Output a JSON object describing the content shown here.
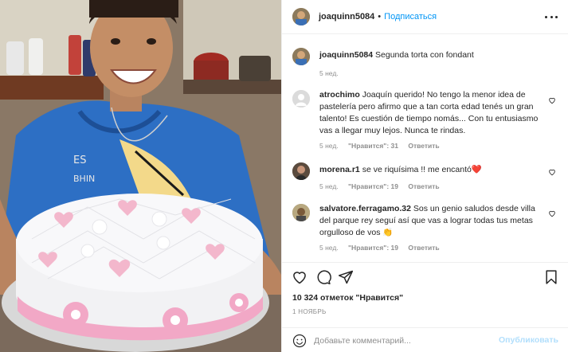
{
  "post": {
    "username": "joaquinn5084",
    "separator": "•",
    "follow_label": "Подписаться",
    "caption": "Segunda torta con fondant",
    "caption_age": "5 нед."
  },
  "comments": [
    {
      "username": "atrochimo",
      "text": "Joaquín querido! No tengo la menor idea de pastelería pero afirmo que a tan corta edad tenés un gran talento! Es cuestión de tiempo nomás... Con tu entusiasmo vas a llegar muy lejos. Nunca te rindas.",
      "age": "5 нед.",
      "likes": "\"Нравится\": 31",
      "reply": "Ответить"
    },
    {
      "username": "morena.r1",
      "text": "se ve riquísima !! me encantó❤️",
      "age": "5 нед.",
      "likes": "\"Нравится\": 19",
      "reply": "Ответить"
    },
    {
      "username": "salvatore.ferragamo.32",
      "text": "Sos un genio saludos desde villa del parque rey seguí así que vas a lograr todas tus metas orgulloso de vos 👏",
      "age": "5 нед.",
      "likes": "\"Нравится\": 19",
      "reply": "Ответить"
    }
  ],
  "stats": {
    "likes_text": "10 324 отметок \"Нравится\"",
    "date": "1 НОЯБРЬ"
  },
  "composer": {
    "placeholder": "Добавьте комментарий...",
    "publish_label": "Опубликовать"
  },
  "icons": {
    "more": "more-horizontal-icon",
    "like": "heart-icon",
    "comment": "comment-icon",
    "share": "paper-plane-icon",
    "save": "bookmark-icon",
    "emoji": "emoji-icon"
  },
  "colors": {
    "link_blue": "#0095f6",
    "publish_disabled": "#b2dffc",
    "muted": "#8e8e8e",
    "text": "#262626",
    "heart_red": "#ed4956"
  }
}
